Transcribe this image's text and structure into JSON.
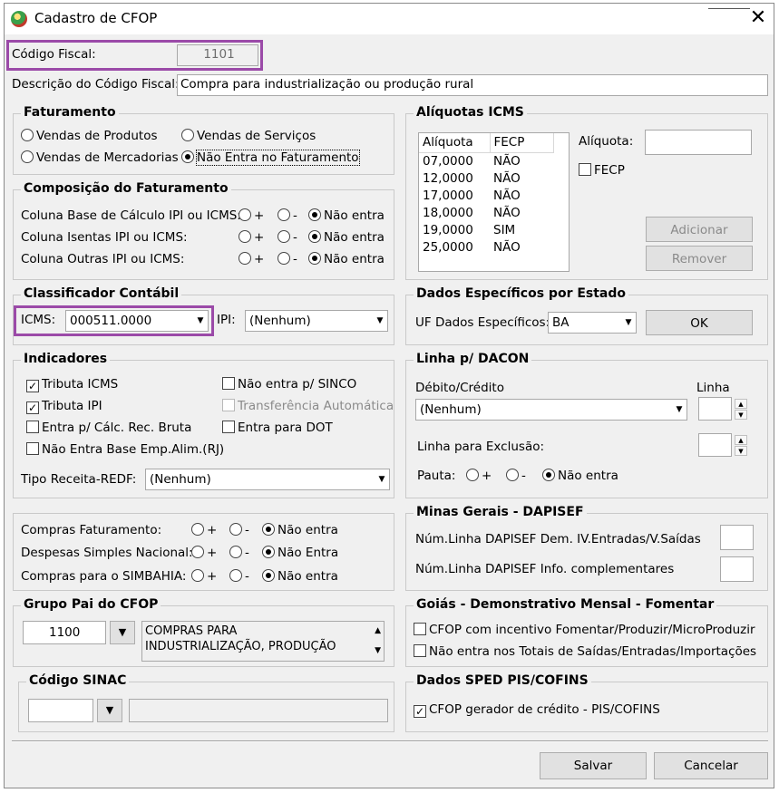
{
  "window": {
    "title": "Cadastro de CFOP"
  },
  "codigo_fiscal": {
    "label": "Código Fiscal:",
    "value": "1101"
  },
  "descricao": {
    "label": "Descrição do Código Fiscal:",
    "value": "Compra para industrialização ou produção rural"
  },
  "faturamento": {
    "title": "Faturamento",
    "options": [
      "Vendas de Produtos",
      "Vendas de Serviços",
      "Vendas de Mercadorias",
      "Não Entra no Faturamento"
    ],
    "selected": "Não Entra no Faturamento"
  },
  "composicao": {
    "title": "Composição do Faturamento",
    "plus": "+",
    "minus": "-",
    "rows": [
      {
        "label": "Coluna Base de Cálculo IPI ou ICMS:",
        "none_label": "Não entra"
      },
      {
        "label": "Coluna Isentas IPI ou ICMS:",
        "none_label": "Não entra"
      },
      {
        "label": "Coluna Outras IPI ou ICMS:",
        "none_label": "Não entra"
      }
    ]
  },
  "aliquotas": {
    "title": "Alíquotas ICMS",
    "columns": [
      "Alíquota",
      "FECP"
    ],
    "rows": [
      [
        "07,0000",
        "NÃO"
      ],
      [
        "12,0000",
        "NÃO"
      ],
      [
        "17,0000",
        "NÃO"
      ],
      [
        "18,0000",
        "NÃO"
      ],
      [
        "19,0000",
        "SIM"
      ],
      [
        "25,0000",
        "NÃO"
      ]
    ],
    "aliquota_label": "Alíquota:",
    "aliquota_value": "",
    "fecp_label": "FECP",
    "adicionar": "Adicionar",
    "remover": "Remover"
  },
  "classificador": {
    "title": "Classificador Contábil",
    "icms_label": "ICMS:",
    "icms_value": "000511.0000",
    "ipi_label": "IPI:",
    "ipi_value": "(Nenhum)"
  },
  "dados_estado": {
    "title": "Dados Específicos por Estado",
    "uf_label": "UF Dados Específicos:",
    "uf_value": "BA",
    "ok": "OK"
  },
  "indicadores": {
    "title": "Indicadores",
    "tributa_icms": "Tributa ICMS",
    "tributa_ipi": "Tributa IPI",
    "entra_calc": "Entra p/ Cálc. Rec. Bruta",
    "nao_entra_base": "Não Entra Base Emp.Alim.(RJ)",
    "nao_entra_sinco": "Não entra p/ SINCO",
    "transferencia": "Transferência Automática",
    "entra_dot": "Entra para DOT",
    "tipo_receita_label": "Tipo Receita-REDF:",
    "tipo_receita_value": "(Nenhum)"
  },
  "dacon": {
    "title": "Linha p/ DACON",
    "debito_label": "Débito/Crédito",
    "debito_value": "(Nenhum)",
    "linha_label": "Linha",
    "exclusao_label": "Linha para Exclusão:",
    "pauta_label": "Pauta:",
    "plus": "+",
    "minus": "-",
    "none_label": "Não entra"
  },
  "compras": {
    "plus": "+",
    "minus": "-",
    "rows": [
      {
        "label": "Compras Faturamento:",
        "none_label": "Não entra"
      },
      {
        "label": "Despesas Simples Nacional:",
        "none_label": "Não Entra"
      },
      {
        "label": "Compras para o SIMBAHIA:",
        "none_label": "Não entra"
      }
    ]
  },
  "minas": {
    "title": "Minas Gerais - DAPISEF",
    "linha1": "Núm.Linha DAPISEF Dem. IV.Entradas/V.Saídas",
    "linha2": "Núm.Linha DAPISEF Info. complementares"
  },
  "grupo_pai": {
    "title": "Grupo Pai do CFOP",
    "code": "1100",
    "desc_line1": "COMPRAS PARA",
    "desc_line2": "INDUSTRIALIZAÇÃO, PRODUÇÃO"
  },
  "goias": {
    "title": "Goiás - Demonstrativo Mensal - Fomentar",
    "cb1": "CFOP com incentivo  Fomentar/Produzir/MicroProduzir",
    "cb2": "Não entra nos Totais de  Saídas/Entradas/Importações"
  },
  "sinac": {
    "title": "Código SINAC",
    "code": "",
    "desc": ""
  },
  "sped": {
    "title": "Dados SPED PIS/COFINS",
    "cb": "CFOP gerador de crédito - PIS/COFINS"
  },
  "footer": {
    "salvar": "Salvar",
    "cancelar": "Cancelar"
  }
}
